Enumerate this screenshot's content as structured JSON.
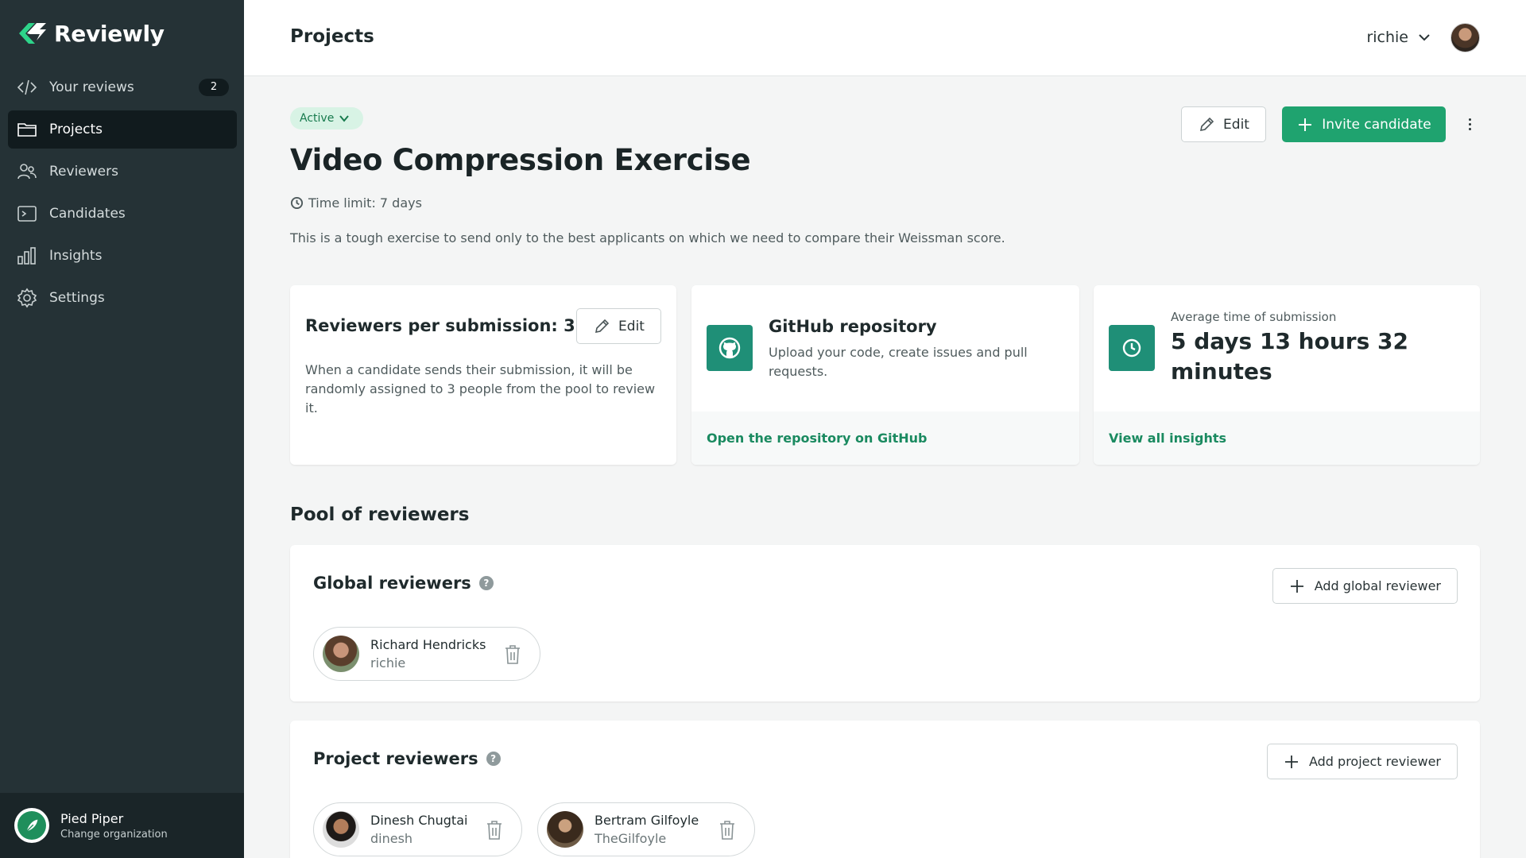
{
  "app": {
    "name": "Reviewly"
  },
  "sidebar": {
    "items": [
      {
        "label": "Your reviews",
        "icon": "code-icon",
        "badge": "2"
      },
      {
        "label": "Projects",
        "icon": "folder-icon",
        "active": true
      },
      {
        "label": "Reviewers",
        "icon": "users-icon"
      },
      {
        "label": "Candidates",
        "icon": "terminal-icon"
      },
      {
        "label": "Insights",
        "icon": "bar-chart-icon"
      },
      {
        "label": "Settings",
        "icon": "gear-icon"
      }
    ],
    "organization": {
      "name": "Pied Piper",
      "action": "Change organization"
    }
  },
  "header": {
    "title": "Projects",
    "user": "richie"
  },
  "project": {
    "status": "Active",
    "title": "Video Compression Exercise",
    "time_limit": "Time limit: 7 days",
    "description": "This is a tough exercise to send only to the best applicants on which we need to compare their Weissman score.",
    "edit_label": "Edit",
    "invite_label": "Invite candidate"
  },
  "cards": {
    "reviewers": {
      "title": "Reviewers per submission: 3",
      "edit_label": "Edit",
      "text": "When a candidate sends their submission, it will be randomly assigned to 3 people from the pool to review it."
    },
    "github": {
      "title": "GitHub repository",
      "text": "Upload your code, create issues and pull requests.",
      "link": "Open the repository on GitHub"
    },
    "insights": {
      "label": "Average time of submission",
      "value": "5 days 13 hours 32 minutes",
      "link": "View all insights"
    }
  },
  "pool": {
    "title": "Pool of reviewers",
    "global": {
      "title": "Global reviewers",
      "add_label": "Add global reviewer",
      "reviewers": [
        {
          "name": "Richard Hendricks",
          "username": "richie"
        }
      ]
    },
    "project": {
      "title": "Project reviewers",
      "add_label": "Add project reviewer",
      "reviewers": [
        {
          "name": "Dinesh Chugtai",
          "username": "dinesh"
        },
        {
          "name": "Bertram Gilfoyle",
          "username": "TheGilfoyle"
        }
      ]
    }
  },
  "colors": {
    "accent": "#1fa36f",
    "sidebar": "#253236",
    "link": "#1a8a60"
  }
}
